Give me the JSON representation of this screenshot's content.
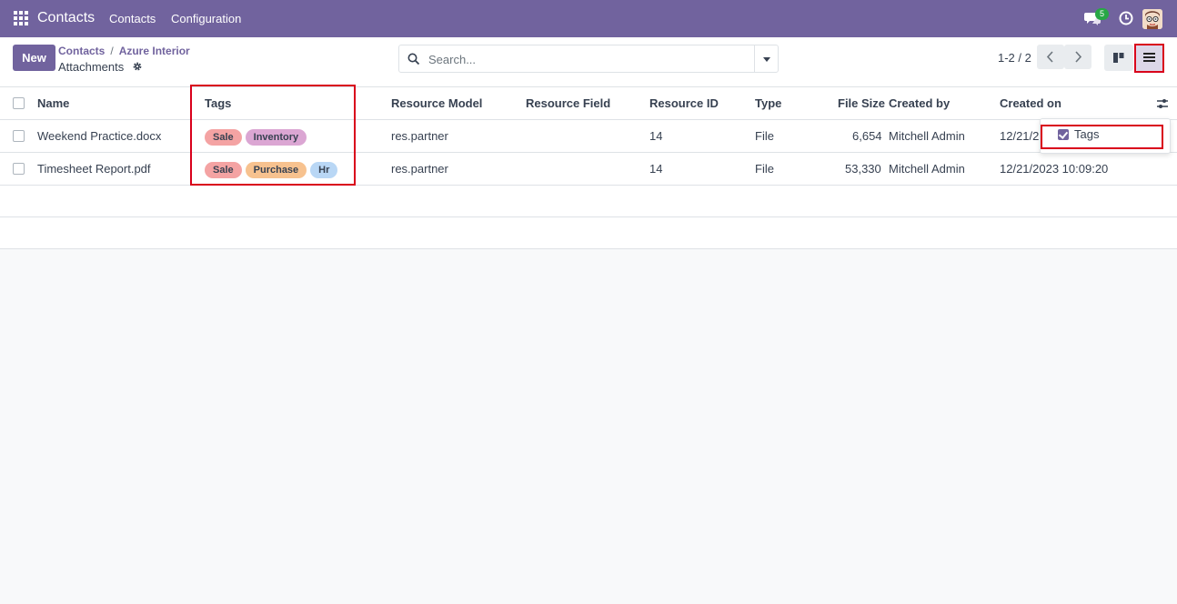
{
  "navbar": {
    "app_name": "Contacts",
    "menu": [
      "Contacts",
      "Configuration"
    ],
    "chat_count": "5",
    "bg_color": "#71639e"
  },
  "control": {
    "new_label": "New",
    "breadcrumb": [
      "Contacts",
      "Azure Interior"
    ],
    "title": "Attachments",
    "search_placeholder": "Search...",
    "pager": "1-2 / 2"
  },
  "table": {
    "columns": [
      "Name",
      "Tags",
      "Resource Model",
      "Resource Field",
      "Resource ID",
      "Type",
      "File Size",
      "Created by",
      "Created on"
    ],
    "rows": [
      {
        "name": "Weekend Practice.docx",
        "tags": [
          {
            "label": "Sale",
            "color": "#f4a3a3"
          },
          {
            "label": "Inventory",
            "color": "#dba6d3"
          }
        ],
        "resource_model": "res.partner",
        "resource_field": "",
        "resource_id": "14",
        "type": "File",
        "file_size": "6,654",
        "created_by": "Mitchell Admin",
        "created_on": "12/21/2"
      },
      {
        "name": "Timesheet Report.pdf",
        "tags": [
          {
            "label": "Sale",
            "color": "#f4a3a3"
          },
          {
            "label": "Purchase",
            "color": "#f7c28f"
          },
          {
            "label": "Hr",
            "color": "#b9d7f5"
          }
        ],
        "resource_model": "res.partner",
        "resource_field": "",
        "resource_id": "14",
        "type": "File",
        "file_size": "53,330",
        "created_by": "Mitchell Admin",
        "created_on": "12/21/2023 10:09:20"
      }
    ]
  },
  "optional_columns": {
    "items": [
      {
        "label": "Tags",
        "checked": true
      }
    ]
  },
  "colors": {
    "accent": "#71639e",
    "highlight": "#d9001b"
  }
}
